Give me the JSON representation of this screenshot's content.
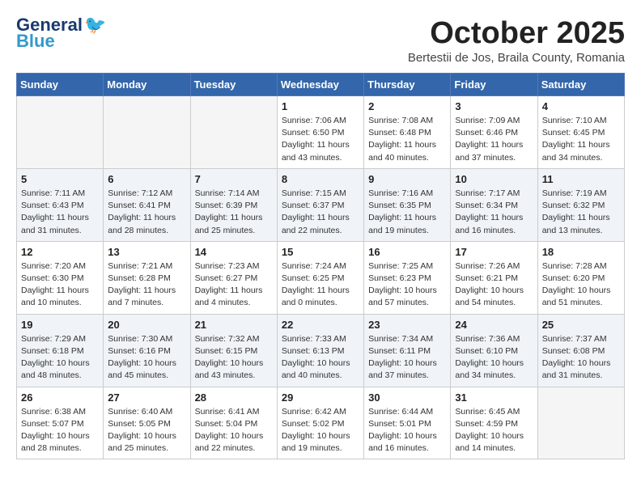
{
  "header": {
    "logo_line1": "General",
    "logo_line2": "Blue",
    "month_title": "October 2025",
    "subtitle": "Bertestii de Jos, Braila County, Romania"
  },
  "days_of_week": [
    "Sunday",
    "Monday",
    "Tuesday",
    "Wednesday",
    "Thursday",
    "Friday",
    "Saturday"
  ],
  "weeks": [
    [
      {
        "day": "",
        "info": ""
      },
      {
        "day": "",
        "info": ""
      },
      {
        "day": "",
        "info": ""
      },
      {
        "day": "1",
        "info": "Sunrise: 7:06 AM\nSunset: 6:50 PM\nDaylight: 11 hours\nand 43 minutes."
      },
      {
        "day": "2",
        "info": "Sunrise: 7:08 AM\nSunset: 6:48 PM\nDaylight: 11 hours\nand 40 minutes."
      },
      {
        "day": "3",
        "info": "Sunrise: 7:09 AM\nSunset: 6:46 PM\nDaylight: 11 hours\nand 37 minutes."
      },
      {
        "day": "4",
        "info": "Sunrise: 7:10 AM\nSunset: 6:45 PM\nDaylight: 11 hours\nand 34 minutes."
      }
    ],
    [
      {
        "day": "5",
        "info": "Sunrise: 7:11 AM\nSunset: 6:43 PM\nDaylight: 11 hours\nand 31 minutes."
      },
      {
        "day": "6",
        "info": "Sunrise: 7:12 AM\nSunset: 6:41 PM\nDaylight: 11 hours\nand 28 minutes."
      },
      {
        "day": "7",
        "info": "Sunrise: 7:14 AM\nSunset: 6:39 PM\nDaylight: 11 hours\nand 25 minutes."
      },
      {
        "day": "8",
        "info": "Sunrise: 7:15 AM\nSunset: 6:37 PM\nDaylight: 11 hours\nand 22 minutes."
      },
      {
        "day": "9",
        "info": "Sunrise: 7:16 AM\nSunset: 6:35 PM\nDaylight: 11 hours\nand 19 minutes."
      },
      {
        "day": "10",
        "info": "Sunrise: 7:17 AM\nSunset: 6:34 PM\nDaylight: 11 hours\nand 16 minutes."
      },
      {
        "day": "11",
        "info": "Sunrise: 7:19 AM\nSunset: 6:32 PM\nDaylight: 11 hours\nand 13 minutes."
      }
    ],
    [
      {
        "day": "12",
        "info": "Sunrise: 7:20 AM\nSunset: 6:30 PM\nDaylight: 11 hours\nand 10 minutes."
      },
      {
        "day": "13",
        "info": "Sunrise: 7:21 AM\nSunset: 6:28 PM\nDaylight: 11 hours\nand 7 minutes."
      },
      {
        "day": "14",
        "info": "Sunrise: 7:23 AM\nSunset: 6:27 PM\nDaylight: 11 hours\nand 4 minutes."
      },
      {
        "day": "15",
        "info": "Sunrise: 7:24 AM\nSunset: 6:25 PM\nDaylight: 11 hours\nand 0 minutes."
      },
      {
        "day": "16",
        "info": "Sunrise: 7:25 AM\nSunset: 6:23 PM\nDaylight: 10 hours\nand 57 minutes."
      },
      {
        "day": "17",
        "info": "Sunrise: 7:26 AM\nSunset: 6:21 PM\nDaylight: 10 hours\nand 54 minutes."
      },
      {
        "day": "18",
        "info": "Sunrise: 7:28 AM\nSunset: 6:20 PM\nDaylight: 10 hours\nand 51 minutes."
      }
    ],
    [
      {
        "day": "19",
        "info": "Sunrise: 7:29 AM\nSunset: 6:18 PM\nDaylight: 10 hours\nand 48 minutes."
      },
      {
        "day": "20",
        "info": "Sunrise: 7:30 AM\nSunset: 6:16 PM\nDaylight: 10 hours\nand 45 minutes."
      },
      {
        "day": "21",
        "info": "Sunrise: 7:32 AM\nSunset: 6:15 PM\nDaylight: 10 hours\nand 43 minutes."
      },
      {
        "day": "22",
        "info": "Sunrise: 7:33 AM\nSunset: 6:13 PM\nDaylight: 10 hours\nand 40 minutes."
      },
      {
        "day": "23",
        "info": "Sunrise: 7:34 AM\nSunset: 6:11 PM\nDaylight: 10 hours\nand 37 minutes."
      },
      {
        "day": "24",
        "info": "Sunrise: 7:36 AM\nSunset: 6:10 PM\nDaylight: 10 hours\nand 34 minutes."
      },
      {
        "day": "25",
        "info": "Sunrise: 7:37 AM\nSunset: 6:08 PM\nDaylight: 10 hours\nand 31 minutes."
      }
    ],
    [
      {
        "day": "26",
        "info": "Sunrise: 6:38 AM\nSunset: 5:07 PM\nDaylight: 10 hours\nand 28 minutes."
      },
      {
        "day": "27",
        "info": "Sunrise: 6:40 AM\nSunset: 5:05 PM\nDaylight: 10 hours\nand 25 minutes."
      },
      {
        "day": "28",
        "info": "Sunrise: 6:41 AM\nSunset: 5:04 PM\nDaylight: 10 hours\nand 22 minutes."
      },
      {
        "day": "29",
        "info": "Sunrise: 6:42 AM\nSunset: 5:02 PM\nDaylight: 10 hours\nand 19 minutes."
      },
      {
        "day": "30",
        "info": "Sunrise: 6:44 AM\nSunset: 5:01 PM\nDaylight: 10 hours\nand 16 minutes."
      },
      {
        "day": "31",
        "info": "Sunrise: 6:45 AM\nSunset: 4:59 PM\nDaylight: 10 hours\nand 14 minutes."
      },
      {
        "day": "",
        "info": ""
      }
    ]
  ]
}
